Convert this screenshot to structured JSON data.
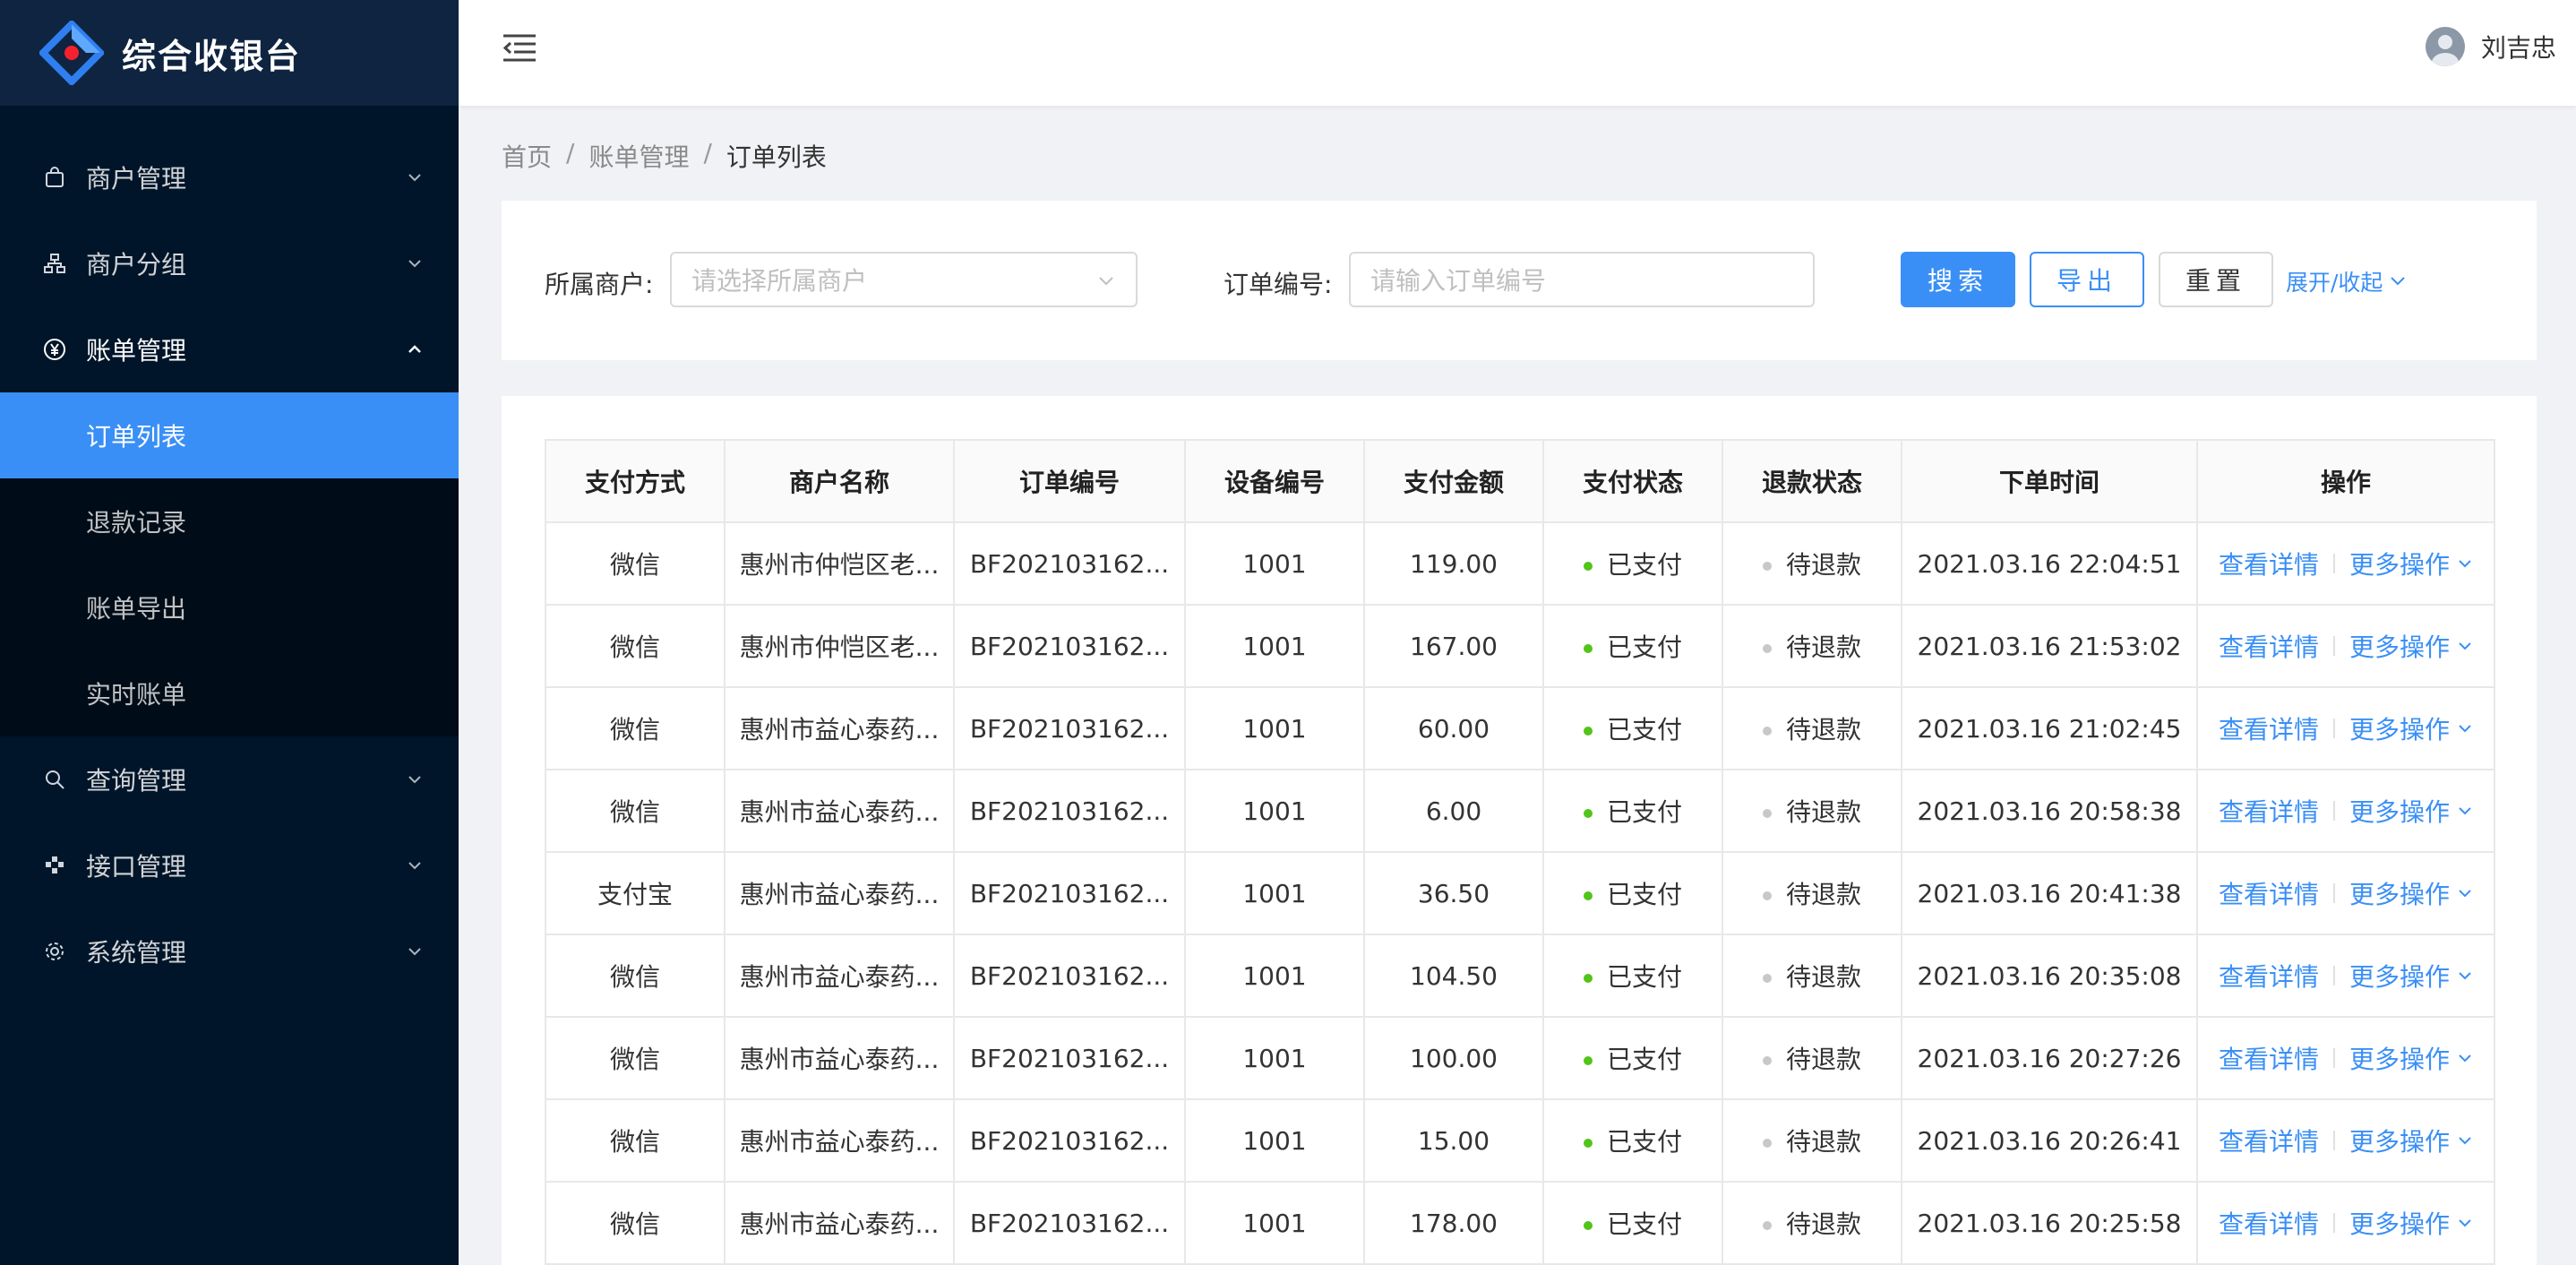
{
  "app": {
    "title": "综合收银台"
  },
  "sidebar": {
    "items": [
      {
        "label": "商户管理",
        "icon": "shopping-bag-icon"
      },
      {
        "label": "商户分组",
        "icon": "org-chart-icon"
      },
      {
        "label": "账单管理",
        "icon": "yen-circle-icon",
        "open": true,
        "children": [
          {
            "label": "订单列表",
            "active": true
          },
          {
            "label": "退款记录"
          },
          {
            "label": "账单导出"
          },
          {
            "label": "实时账单"
          }
        ]
      },
      {
        "label": "查询管理",
        "icon": "search-icon"
      },
      {
        "label": "接口管理",
        "icon": "api-icon"
      },
      {
        "label": "系统管理",
        "icon": "gear-icon"
      }
    ]
  },
  "header": {
    "user_name": "刘吉忠"
  },
  "breadcrumb": [
    "首页",
    "账单管理",
    "订单列表"
  ],
  "search": {
    "merchant_label": "所属商户:",
    "merchant_placeholder": "请选择所属商户",
    "order_label": "订单编号:",
    "order_placeholder": "请输入订单编号",
    "search_btn": "搜索",
    "export_btn": "导出",
    "reset_btn": "重置",
    "toggle_link": "展开/收起"
  },
  "table": {
    "columns": [
      "支付方式",
      "商户名称",
      "订单编号",
      "设备编号",
      "支付金额",
      "支付状态",
      "退款状态",
      "下单时间",
      "操作"
    ],
    "rows": [
      {
        "pay": "微信",
        "merchant": "惠州市仲恺区老...",
        "order": "BF202103162...",
        "device": "1001",
        "amount": "119.00",
        "pay_status": "已支付",
        "refund_status": "待退款",
        "time": "2021.03.16 22:04:51"
      },
      {
        "pay": "微信",
        "merchant": "惠州市仲恺区老...",
        "order": "BF202103162...",
        "device": "1001",
        "amount": "167.00",
        "pay_status": "已支付",
        "refund_status": "待退款",
        "time": "2021.03.16 21:53:02"
      },
      {
        "pay": "微信",
        "merchant": "惠州市益心泰药...",
        "order": "BF202103162...",
        "device": "1001",
        "amount": "60.00",
        "pay_status": "已支付",
        "refund_status": "待退款",
        "time": "2021.03.16 21:02:45"
      },
      {
        "pay": "微信",
        "merchant": "惠州市益心泰药...",
        "order": "BF202103162...",
        "device": "1001",
        "amount": "6.00",
        "pay_status": "已支付",
        "refund_status": "待退款",
        "time": "2021.03.16 20:58:38"
      },
      {
        "pay": "支付宝",
        "merchant": "惠州市益心泰药...",
        "order": "BF202103162...",
        "device": "1001",
        "amount": "36.50",
        "pay_status": "已支付",
        "refund_status": "待退款",
        "time": "2021.03.16 20:41:38"
      },
      {
        "pay": "微信",
        "merchant": "惠州市益心泰药...",
        "order": "BF202103162...",
        "device": "1001",
        "amount": "104.50",
        "pay_status": "已支付",
        "refund_status": "待退款",
        "time": "2021.03.16 20:35:08"
      },
      {
        "pay": "微信",
        "merchant": "惠州市益心泰药...",
        "order": "BF202103162...",
        "device": "1001",
        "amount": "100.00",
        "pay_status": "已支付",
        "refund_status": "待退款",
        "time": "2021.03.16 20:27:26"
      },
      {
        "pay": "微信",
        "merchant": "惠州市益心泰药...",
        "order": "BF202103162...",
        "device": "1001",
        "amount": "15.00",
        "pay_status": "已支付",
        "refund_status": "待退款",
        "time": "2021.03.16 20:26:41"
      },
      {
        "pay": "微信",
        "merchant": "惠州市益心泰药...",
        "order": "BF202103162...",
        "device": "1001",
        "amount": "178.00",
        "pay_status": "已支付",
        "refund_status": "待退款",
        "time": "2021.03.16 20:25:58"
      }
    ],
    "op_view": "查看详情",
    "op_more": "更多操作"
  },
  "colors": {
    "sider_bg": "#001529",
    "accent": "#3a8ff6",
    "paid_dot": "#52c41a",
    "refund_dot": "#c8c8c8"
  }
}
